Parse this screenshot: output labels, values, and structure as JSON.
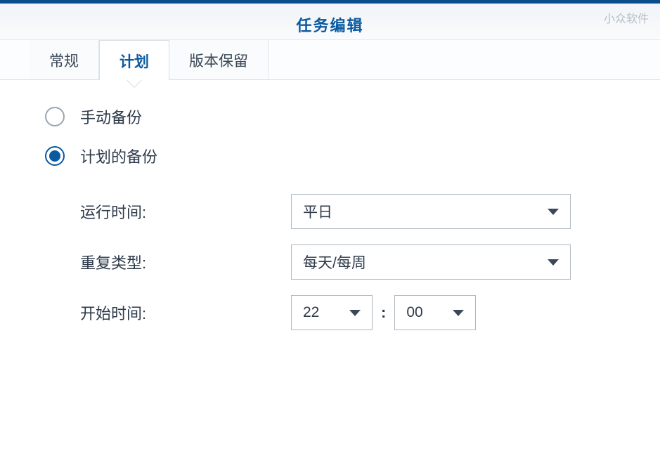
{
  "window": {
    "title": "任务编辑",
    "watermark": "小众软件"
  },
  "tabs": [
    {
      "label": "常规",
      "active": false
    },
    {
      "label": "计划",
      "active": true
    },
    {
      "label": "版本保留",
      "active": false
    }
  ],
  "schedule": {
    "mode_manual": {
      "label": "手动备份",
      "selected": false
    },
    "mode_scheduled": {
      "label": "计划的备份",
      "selected": true
    },
    "run_time": {
      "label": "运行时间:",
      "value": "平日"
    },
    "repeat_type": {
      "label": "重复类型:",
      "value": "每天/每周"
    },
    "start_time": {
      "label": "开始时间:",
      "hour": "22",
      "separator": ":",
      "minute": "00"
    }
  }
}
